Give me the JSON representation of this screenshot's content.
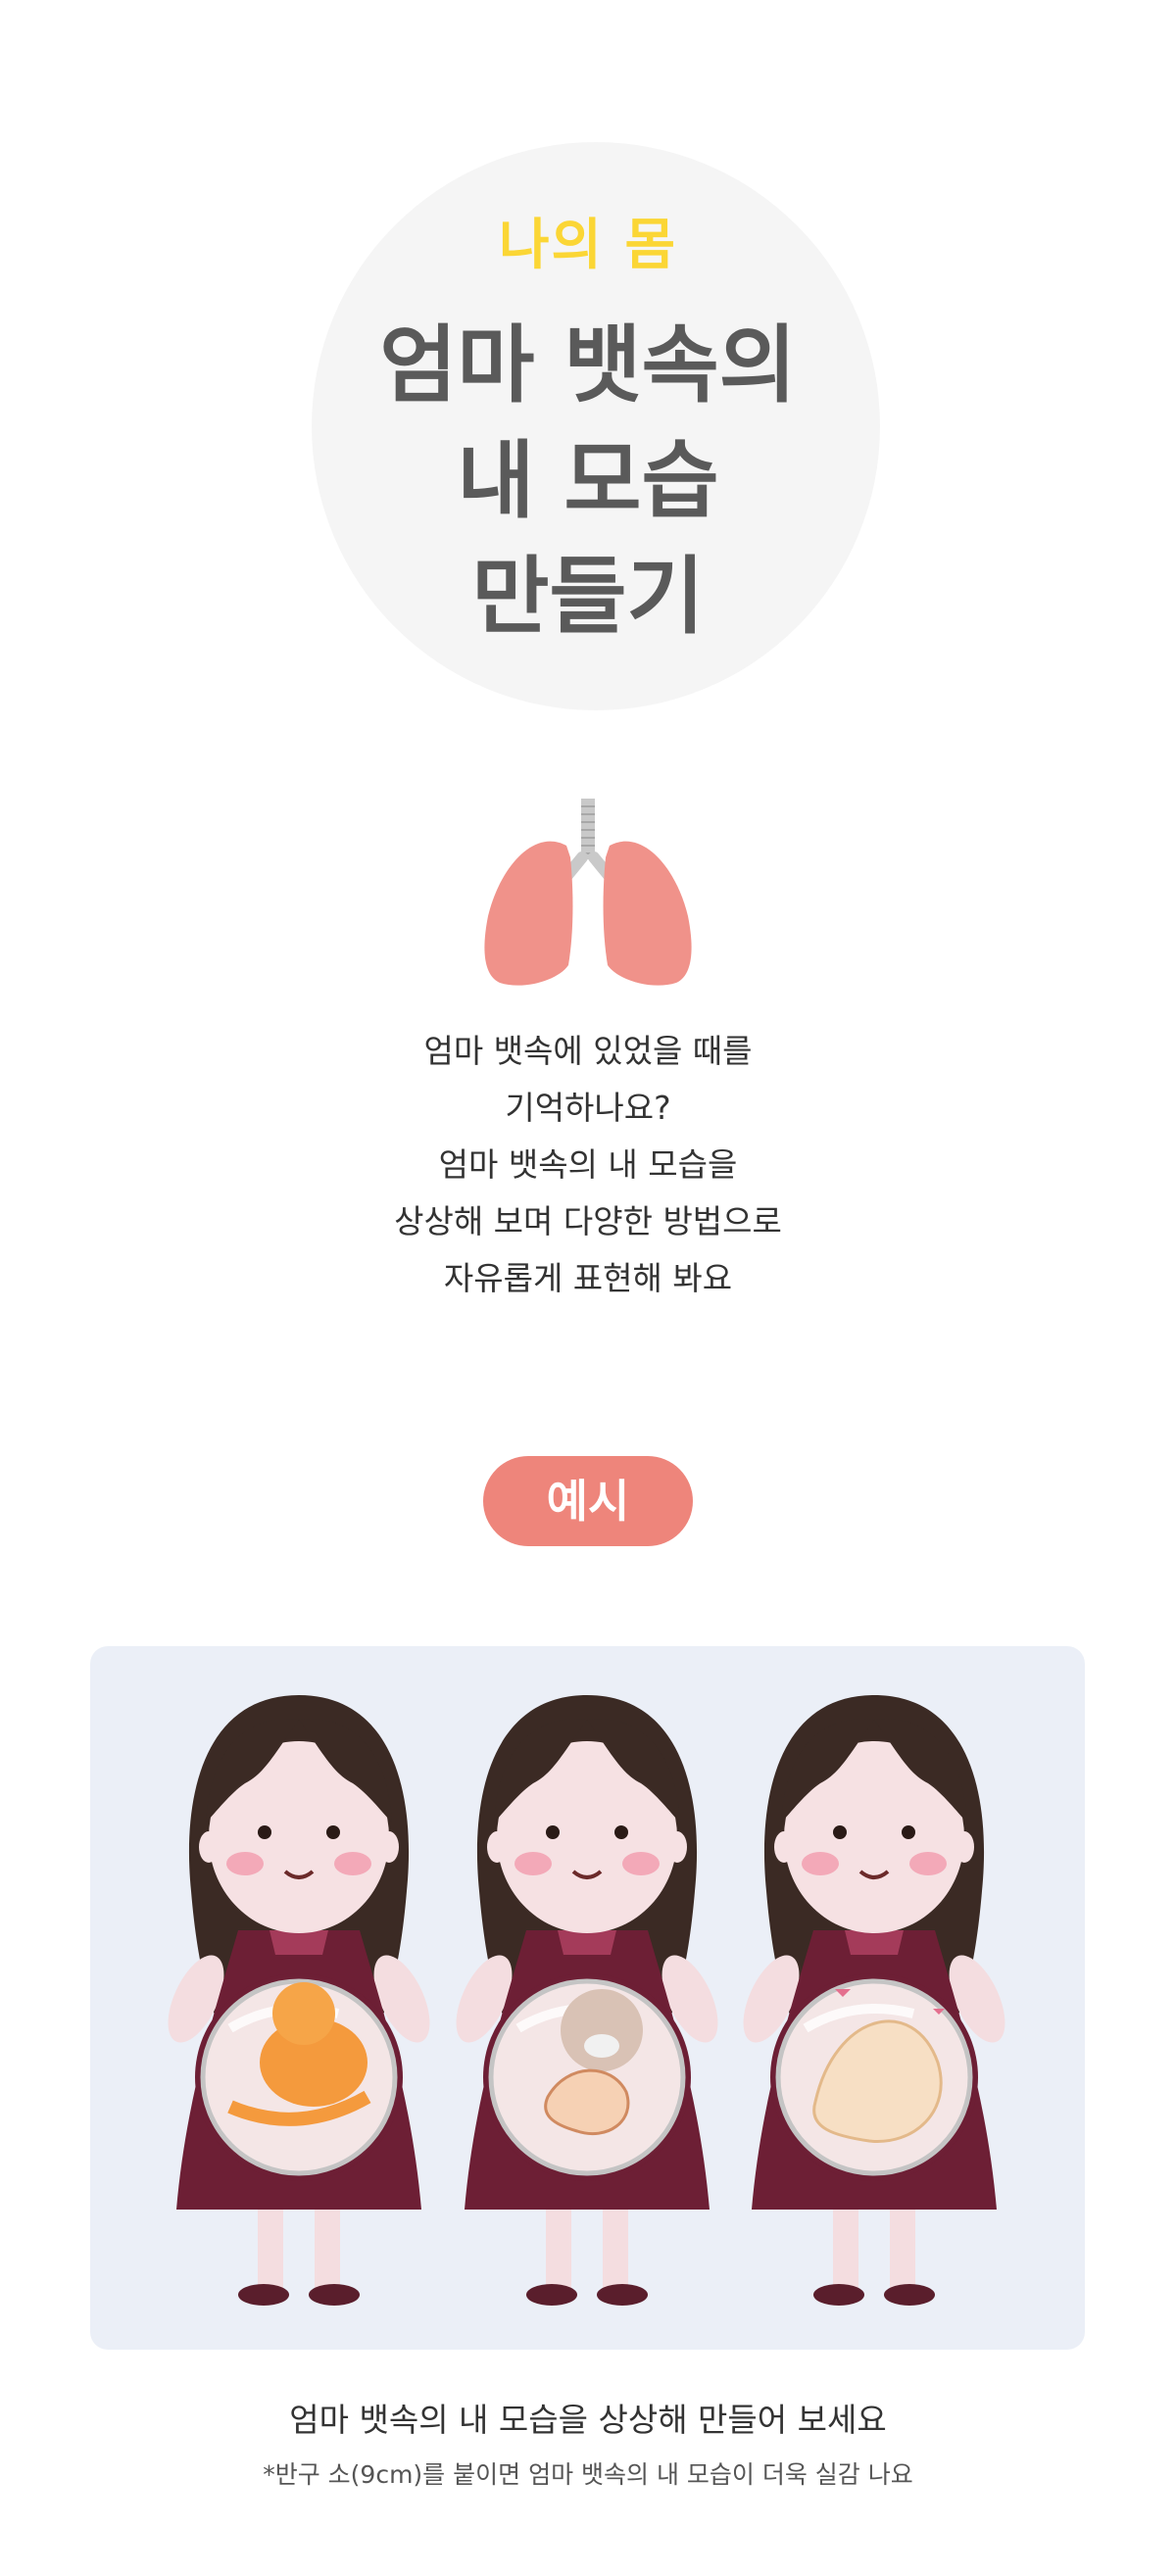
{
  "header": {
    "eyebrow": "나의 몸",
    "title_lines": [
      "엄마 뱃속의",
      "내 모습",
      "만들기"
    ]
  },
  "icon": "lungs-icon",
  "description_lines": [
    "엄마 뱃속에 있었을 때를",
    "기억하나요?",
    "엄마 뱃속의 내 모습을",
    "상상해 보며 다양한 방법으로",
    "자유롭게 표현해 봐요"
  ],
  "example": {
    "badge": "예시",
    "caption": "엄마 뱃속의 내 모습을 상상해 만들어 보세요",
    "note": "*반구 소(9cm)를 붙이면 엄마 뱃속의 내 모습이 더욱 실감 나요"
  },
  "colors": {
    "accent_yellow": "#fbd635",
    "accent_pink": "#ee857b",
    "circle_bg": "#f5f5f5",
    "photo_bg": "#ebeff7"
  }
}
